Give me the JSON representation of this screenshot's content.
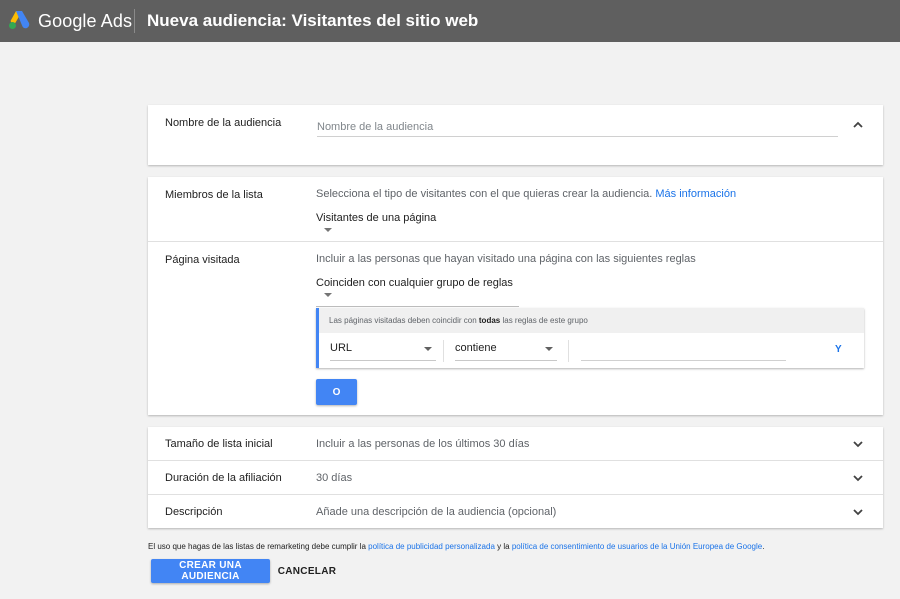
{
  "header": {
    "brand": "Google Ads",
    "title": "Nueva audiencia: Visitantes del sitio web",
    "logo_icon": "google-ads-logo",
    "background": "#5f5f5f"
  },
  "audience_name": {
    "label": "Nombre de la audiencia",
    "placeholder": "Nombre de la audiencia",
    "value": "",
    "toggle_icon": "chevron-up-icon"
  },
  "list_members": {
    "label": "Miembros de la lista",
    "description": "Selecciona el tipo de visitantes con el que quieras crear la audiencia.",
    "more_info": "Más información",
    "selected": "Visitantes de una página"
  },
  "visited_page": {
    "label": "Página visitada",
    "description": "Incluir a las personas que hayan visitado una página con las siguientes reglas",
    "selected": "Coinciden con cualquier grupo de reglas",
    "rule_group": {
      "header_prefix": "Las páginas visitadas deben coincidir con",
      "header_emphasis": "todas",
      "header_suffix": "las reglas de este grupo",
      "field": "URL",
      "operator": "contiene",
      "value": "",
      "and_label": "Y"
    },
    "or_label": "O"
  },
  "rows": [
    {
      "label": "Tamaño de lista inicial",
      "value": "Incluir a las personas de los últimos 30 días"
    },
    {
      "label": "Duración de la afiliación",
      "value": "30 días"
    },
    {
      "label": "Descripción",
      "value": "Añade una descripción de la audiencia (opcional)"
    }
  ],
  "footer": {
    "note_prefix": "El uso que hagas de las listas de remarketing debe cumplir la",
    "link1": "política de publicidad personalizada",
    "note_mid": "y la",
    "link2": "política de consentimiento de usuarios de la Unión Europea de Google",
    "note_suffix": ".",
    "create_label": "CREAR UNA AUDIENCIA",
    "cancel_label": "CANCELAR"
  },
  "colors": {
    "accent": "#4285f4",
    "link": "#1a73e8"
  }
}
